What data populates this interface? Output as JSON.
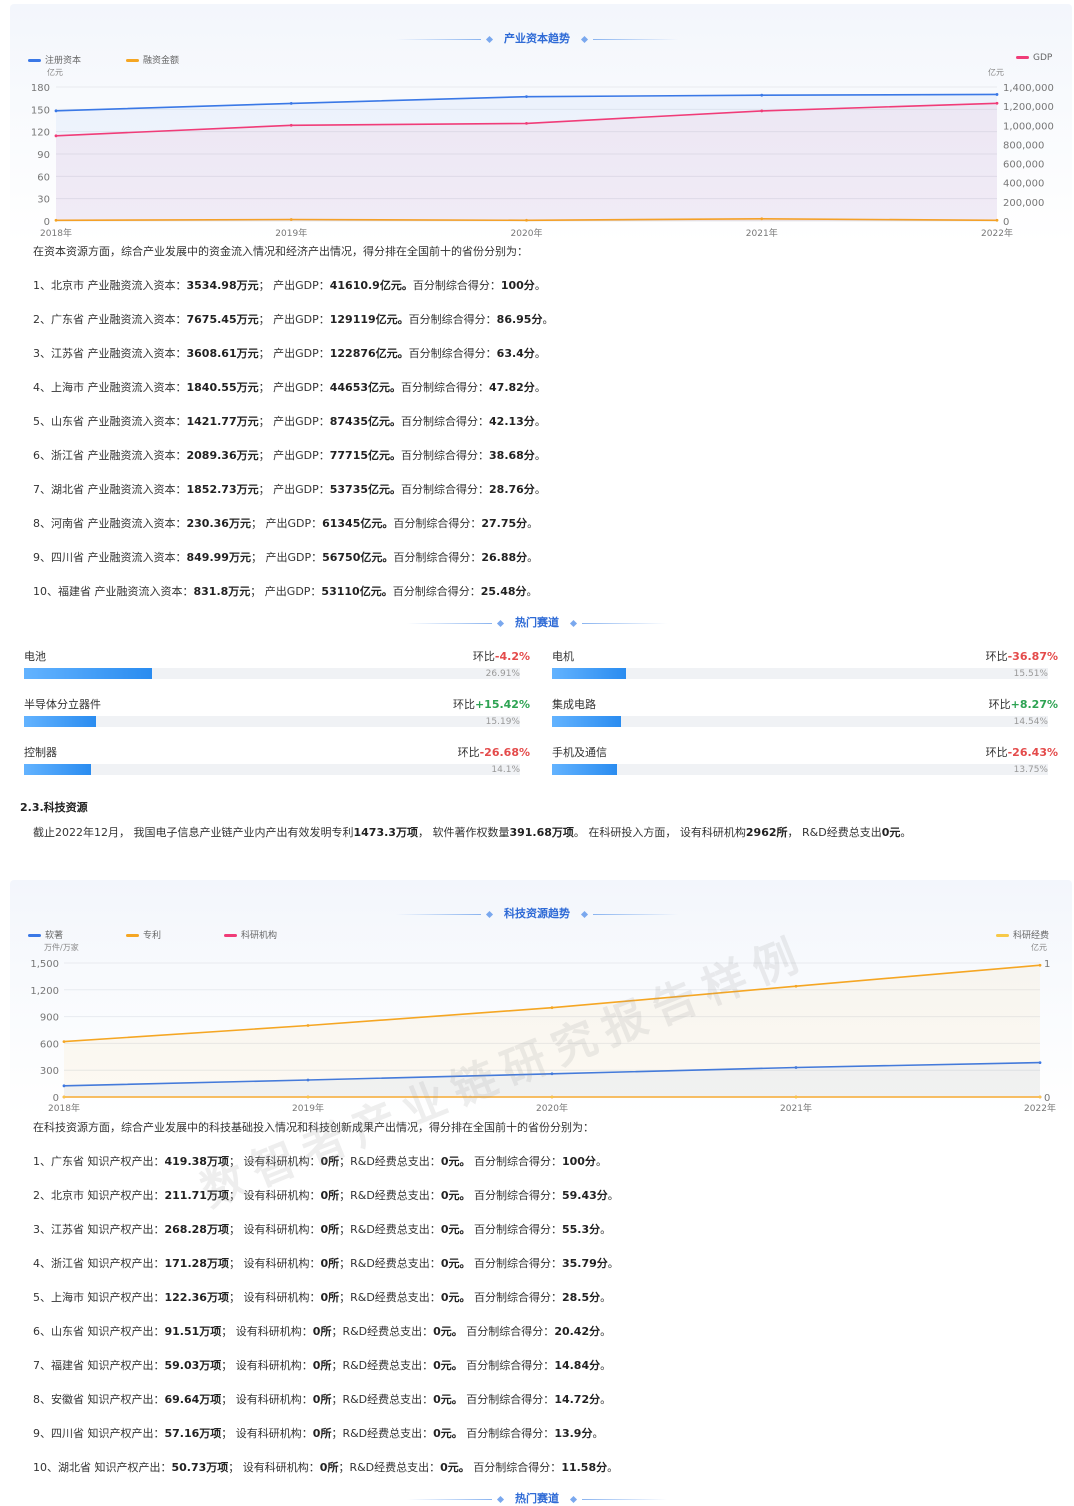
{
  "capital": {
    "title": "产业资本趋势",
    "legend": [
      {
        "name": "注册资本",
        "color": "#3a78e6"
      },
      {
        "name": "融资金额",
        "color": "#f5a623"
      },
      {
        "name": "GDP",
        "color": "#f03c78"
      }
    ],
    "unit_left": "亿元",
    "unit_right": "亿元",
    "intro": "在资本资源方面，综合产业发展中的资金流入情况和经济产出情况，得分排在全国前十的省份分别为：",
    "rows": [
      {
        "idx": "1、",
        "name": "北京市",
        "l1": " 产业融资流入资本：",
        "v1": "3534.98万元",
        "l2": "；  产出GDP：",
        "v2": "41610.9亿元。",
        "l3": "百分制综合得分：",
        "v3": "100分",
        "end": "。"
      },
      {
        "idx": "2、",
        "name": "广东省",
        "l1": " 产业融资流入资本：",
        "v1": "7675.45万元",
        "l2": "；  产出GDP：",
        "v2": "129119亿元。",
        "l3": "百分制综合得分：",
        "v3": "86.95分",
        "end": "。"
      },
      {
        "idx": "3、",
        "name": "江苏省",
        "l1": " 产业融资流入资本：",
        "v1": "3608.61万元",
        "l2": "；  产出GDP：",
        "v2": "122876亿元。",
        "l3": "百分制综合得分：",
        "v3": "63.4分",
        "end": "。"
      },
      {
        "idx": "4、",
        "name": "上海市",
        "l1": " 产业融资流入资本：",
        "v1": "1840.55万元",
        "l2": "；  产出GDP：",
        "v2": "44653亿元。",
        "l3": "百分制综合得分：",
        "v3": "47.82分",
        "end": "。"
      },
      {
        "idx": "5、",
        "name": "山东省",
        "l1": " 产业融资流入资本：",
        "v1": "1421.77万元",
        "l2": "；  产出GDP：",
        "v2": "87435亿元。",
        "l3": "百分制综合得分：",
        "v3": "42.13分",
        "end": "。"
      },
      {
        "idx": "6、",
        "name": "浙江省",
        "l1": " 产业融资流入资本：",
        "v1": "2089.36万元",
        "l2": "；  产出GDP：",
        "v2": "77715亿元。",
        "l3": "百分制综合得分：",
        "v3": "38.68分",
        "end": "。"
      },
      {
        "idx": "7、",
        "name": "湖北省",
        "l1": " 产业融资流入资本：",
        "v1": "1852.73万元",
        "l2": "；  产出GDP：",
        "v2": "53735亿元。",
        "l3": "百分制综合得分：",
        "v3": "28.76分",
        "end": "。"
      },
      {
        "idx": "8、",
        "name": "河南省",
        "l1": " 产业融资流入资本：",
        "v1": "230.36万元",
        "l2": "；  产出GDP：",
        "v2": "61345亿元。",
        "l3": "百分制综合得分：",
        "v3": "27.75分",
        "end": "。"
      },
      {
        "idx": "9、",
        "name": "四川省",
        "l1": " 产业融资流入资本：",
        "v1": "849.99万元",
        "l2": "；  产出GDP：",
        "v2": "56750亿元。",
        "l3": "百分制综合得分：",
        "v3": "26.88分",
        "end": "。"
      },
      {
        "idx": "10、",
        "name": "福建省",
        "l1": " 产业融资流入资本：",
        "v1": "831.8万元",
        "l2": "；  产出GDP：",
        "v2": "53110亿元。",
        "l3": "百分制综合得分：",
        "v3": "25.48分",
        "end": "。"
      }
    ]
  },
  "hot_tracks": {
    "title": "热门赛道",
    "change_label": "环比",
    "items": [
      {
        "name": "电池",
        "change": "-4.2%",
        "dir": "down",
        "share": "26.91%",
        "pct": 26.91
      },
      {
        "name": "电机",
        "change": "-36.87%",
        "dir": "down",
        "share": "15.51%",
        "pct": 15.51
      },
      {
        "name": "半导体分立器件",
        "change": "+15.42%",
        "dir": "up",
        "share": "15.19%",
        "pct": 15.19
      },
      {
        "name": "集成电路",
        "change": "+8.27%",
        "dir": "up",
        "share": "14.54%",
        "pct": 14.54
      },
      {
        "name": "控制器",
        "change": "-26.68%",
        "dir": "down",
        "share": "14.1%",
        "pct": 14.1
      },
      {
        "name": "手机及通信",
        "change": "-26.43%",
        "dir": "down",
        "share": "13.75%",
        "pct": 13.75
      }
    ]
  },
  "tech_heading": "2.3.科技资源",
  "tech_summary": {
    "p1": "截止2022年12月，  我国电子信息产业链产业内产出有效发明专利",
    "v1": "1473.3万项",
    "p2": "，  软件著作权数量",
    "v2": "391.68万项",
    "p3": "。  在科研投入方面，  设有科研机构",
    "v3": "2962所",
    "p4": "，  R&D经费总支出",
    "v4": "0元",
    "p5": "。"
  },
  "tech": {
    "title": "科技资源趋势",
    "legend": [
      {
        "name": "软著",
        "color": "#3a78e6"
      },
      {
        "name": "专利",
        "color": "#f5a623"
      },
      {
        "name": "科研机构",
        "color": "#f03c78"
      },
      {
        "name": "科研经费",
        "color": "#f7c948"
      }
    ],
    "unit_left": "万件/万家",
    "unit_right": "亿元",
    "intro": "在科技资源方面，综合产业发展中的科技基础投入情况和科技创新成果产出情况，得分排在全国前十的省份分别为：",
    "rows": [
      {
        "idx": "1、",
        "name": "广东省",
        "l1": " 知识产权产出：",
        "v1": "419.38万项",
        "l2": "；  设有科研机构：",
        "v2": "0所",
        "l3": "；R&D经费总支出：",
        "v3": "0元。",
        "l4": "  百分制综合得分：",
        "v4": "100分",
        "end": "。"
      },
      {
        "idx": "2、",
        "name": "北京市",
        "l1": " 知识产权产出：",
        "v1": "211.71万项",
        "l2": "；  设有科研机构：",
        "v2": "0所",
        "l3": "；R&D经费总支出：",
        "v3": "0元。",
        "l4": "  百分制综合得分：",
        "v4": "59.43分",
        "end": "。"
      },
      {
        "idx": "3、",
        "name": "江苏省",
        "l1": " 知识产权产出：",
        "v1": "268.28万项",
        "l2": "；  设有科研机构：",
        "v2": "0所",
        "l3": "；R&D经费总支出：",
        "v3": "0元。",
        "l4": "  百分制综合得分：",
        "v4": "55.3分",
        "end": "。"
      },
      {
        "idx": "4、",
        "name": "浙江省",
        "l1": " 知识产权产出：",
        "v1": "171.28万项",
        "l2": "；  设有科研机构：",
        "v2": "0所",
        "l3": "；R&D经费总支出：",
        "v3": "0元。",
        "l4": "  百分制综合得分：",
        "v4": "35.79分",
        "end": "。"
      },
      {
        "idx": "5、",
        "name": "上海市",
        "l1": " 知识产权产出：",
        "v1": "122.36万项",
        "l2": "；  设有科研机构：",
        "v2": "0所",
        "l3": "；R&D经费总支出：",
        "v3": "0元。",
        "l4": "  百分制综合得分：",
        "v4": "28.5分",
        "end": "。"
      },
      {
        "idx": "6、",
        "name": "山东省",
        "l1": " 知识产权产出：",
        "v1": "91.51万项",
        "l2": "；  设有科研机构：",
        "v2": "0所",
        "l3": "；R&D经费总支出：",
        "v3": "0元。",
        "l4": "  百分制综合得分：",
        "v4": "20.42分",
        "end": "。"
      },
      {
        "idx": "7、",
        "name": "福建省",
        "l1": " 知识产权产出：",
        "v1": "59.03万项",
        "l2": "；  设有科研机构：",
        "v2": "0所",
        "l3": "；R&D经费总支出：",
        "v3": "0元。",
        "l4": "  百分制综合得分：",
        "v4": "14.84分",
        "end": "。"
      },
      {
        "idx": "8、",
        "name": "安徽省",
        "l1": " 知识产权产出：",
        "v1": "69.64万项",
        "l2": "；  设有科研机构：",
        "v2": "0所",
        "l3": "；R&D经费总支出：",
        "v3": "0元。",
        "l4": "  百分制综合得分：",
        "v4": "14.72分",
        "end": "。"
      },
      {
        "idx": "9、",
        "name": "四川省",
        "l1": " 知识产权产出：",
        "v1": "57.16万项",
        "l2": "；  设有科研机构：",
        "v2": "0所",
        "l3": "；R&D经费总支出：",
        "v3": "0元。",
        "l4": "  百分制综合得分：",
        "v4": "13.9分",
        "end": "。"
      },
      {
        "idx": "10、",
        "name": "湖北省",
        "l1": " 知识产权产出：",
        "v1": "50.73万项",
        "l2": "；  设有科研机构：",
        "v2": "0所",
        "l3": "；R&D经费总支出：",
        "v3": "0元。",
        "l4": "  百分制综合得分：",
        "v4": "11.58分",
        "end": "。"
      }
    ]
  },
  "bottom_title": "热门赛道",
  "watermark": "数智者产业链研究报告样例",
  "chart_data": [
    {
      "type": "line",
      "title": "产业资本趋势",
      "x": [
        "2018年",
        "2019年",
        "2020年",
        "2021年",
        "2022年"
      ],
      "ylim_left": [
        0,
        180
      ],
      "yticks_left": [
        "0",
        "30",
        "60",
        "90",
        "120",
        "150",
        "180"
      ],
      "ylim_right": [
        0,
        1400000
      ],
      "yticks_right": [
        "0",
        "200,000",
        "400,000",
        "600,000",
        "800,000",
        "1,000,000",
        "1,200,000",
        "1,400,000"
      ],
      "grid": true,
      "legend_position": "top",
      "series": [
        {
          "name": "注册资本",
          "axis": "left",
          "color": "#3a78e6",
          "values": [
            148,
            158,
            167,
            169,
            170
          ]
        },
        {
          "name": "融资金额",
          "axis": "left",
          "color": "#f5a623",
          "values": [
            1,
            2,
            1,
            3,
            1
          ]
        },
        {
          "name": "GDP",
          "axis": "right",
          "color": "#f03c78",
          "values": [
            890000,
            1000000,
            1020000,
            1150000,
            1230000
          ]
        }
      ]
    },
    {
      "type": "line",
      "title": "科技资源趋势",
      "x": [
        "2018年",
        "2019年",
        "2020年",
        "2021年",
        "2022年"
      ],
      "ylim_left": [
        0,
        1500
      ],
      "yticks_left": [
        "0",
        "300",
        "600",
        "900",
        "1,200",
        "1,500"
      ],
      "ylim_right": [
        0,
        1
      ],
      "yticks_right": [
        "0",
        "1"
      ],
      "grid": true,
      "legend_position": "top",
      "series": [
        {
          "name": "软著",
          "axis": "left",
          "color": "#3a78e6",
          "values": [
            125,
            190,
            260,
            330,
            385
          ]
        },
        {
          "name": "专利",
          "axis": "left",
          "color": "#f5a623",
          "values": [
            620,
            800,
            1000,
            1240,
            1475
          ]
        },
        {
          "name": "科研机构",
          "axis": "left",
          "color": "#f03c78",
          "values": [
            0,
            0,
            0,
            0,
            0
          ]
        },
        {
          "name": "科研经费",
          "axis": "right",
          "color": "#f7c948",
          "values": [
            0,
            0,
            0,
            0,
            0
          ]
        }
      ]
    }
  ]
}
